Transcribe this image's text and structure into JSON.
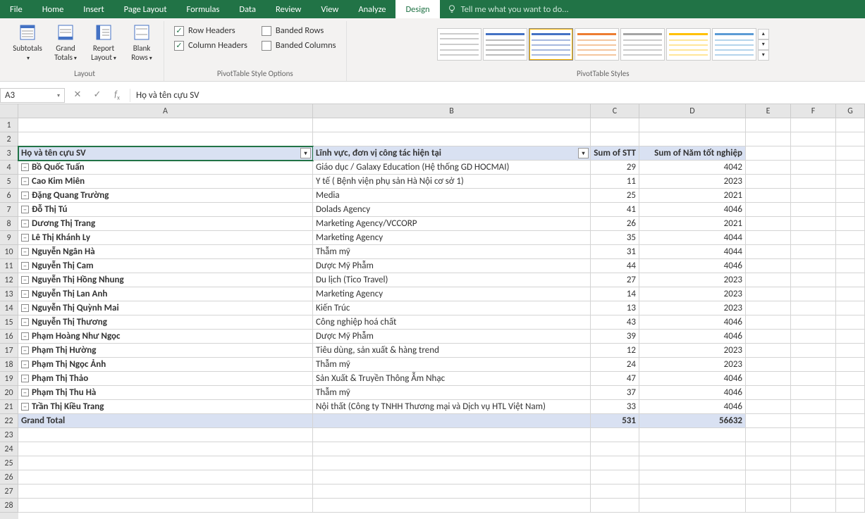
{
  "ribbon": {
    "tabs": [
      "File",
      "Home",
      "Insert",
      "Page Layout",
      "Formulas",
      "Data",
      "Review",
      "View",
      "Analyze",
      "Design"
    ],
    "active_tab": "Design",
    "tell_me": "Tell me what you want to do...",
    "groups": {
      "layout": {
        "label": "Layout",
        "buttons": {
          "subtotals": "Subtotals",
          "grand_totals": "Grand Totals",
          "report_layout": "Report Layout",
          "blank_rows": "Blank Rows"
        }
      },
      "style_options": {
        "label": "PivotTable Style Options",
        "row_headers": "Row Headers",
        "column_headers": "Column Headers",
        "banded_rows": "Banded Rows",
        "banded_columns": "Banded Columns",
        "row_headers_checked": true,
        "column_headers_checked": true,
        "banded_rows_checked": false,
        "banded_columns_checked": false
      },
      "styles": {
        "label": "PivotTable Styles"
      }
    }
  },
  "formula_bar": {
    "name_box": "A3",
    "formula": "Họ và tên cựu SV"
  },
  "columns": [
    "A",
    "B",
    "C",
    "D",
    "E",
    "F",
    "G"
  ],
  "pivot_headers": {
    "A": "Họ và tên cựu SV",
    "B": "Lĩnh vực, đơn vị công tác hiện tại",
    "C": "Sum of STT",
    "D": "Sum of Năm tốt nghiệp"
  },
  "pivot_rows": [
    {
      "name": "Bồ Quốc Tuấn",
      "b": "Giáo dục / Galaxy Education (Hệ thống GD HOCMAI)",
      "c": "29",
      "d": "4042"
    },
    {
      "name": "Cao Kim Miên",
      "b": "Y tế ( Bệnh viện phụ sản Hà Nội cơ sở 1)",
      "c": "11",
      "d": "2023"
    },
    {
      "name": "Đặng Quang Trường",
      "b": "Media",
      "c": "25",
      "d": "2021"
    },
    {
      "name": "Đỗ Thị Tú",
      "b": "Dolads Agency",
      "c": "41",
      "d": "4046"
    },
    {
      "name": "Dương Thị Trang",
      "b": "Marketing Agency/VCCORP",
      "c": "26",
      "d": "2021"
    },
    {
      "name": "Lê Thị Khánh Ly",
      "b": "Marketing Agency",
      "c": "35",
      "d": "4044"
    },
    {
      "name": "Nguyễn Ngân Hà",
      "b": "Thẫm mỹ",
      "c": "31",
      "d": "4044"
    },
    {
      "name": "Nguyễn Thị Cam",
      "b": "Dược Mỹ Phẫm",
      "c": "44",
      "d": "4046"
    },
    {
      "name": "Nguyễn Thị Hồng Nhung",
      "b": "Du lịch (Tico Travel)",
      "c": "27",
      "d": "2023"
    },
    {
      "name": "Nguyễn Thị Lan Anh",
      "b": "Marketing Agency",
      "c": "14",
      "d": "2023"
    },
    {
      "name": "Nguyễn Thị Quỳnh Mai",
      "b": "Kiến Trúc",
      "c": "13",
      "d": "2023"
    },
    {
      "name": "Nguyễn Thị Thương",
      "b": "Công nghiệp hoá chất",
      "c": "43",
      "d": "4046"
    },
    {
      "name": "Phạm Hoàng Như Ngọc",
      "b": "Dược Mỹ Phẫm",
      "c": "39",
      "d": "4046"
    },
    {
      "name": "Phạm Thị Hường",
      "b": "Tiêu dùng, sản xuất & hàng trend",
      "c": "12",
      "d": "2023"
    },
    {
      "name": "Phạm Thị Ngọc Ảnh",
      "b": "Thẫm mỹ",
      "c": "24",
      "d": "2023"
    },
    {
      "name": "Phạm Thị Thảo",
      "b": "Sản Xuất & Truyền Thông Ẫm Nhạc",
      "c": "47",
      "d": "4046"
    },
    {
      "name": "Phạm Thị Thu Hà",
      "b": "Thẫm mỹ",
      "c": "37",
      "d": "4046"
    },
    {
      "name": "Trần Thị Kiều Trang",
      "b": "Nội thất (Công ty TNHH Thương mại và Dịch vụ HTL Việt Nam)",
      "c": "33",
      "d": "4046"
    }
  ],
  "grand_total": {
    "label": "Grand Total",
    "c": "531",
    "d": "56632"
  },
  "row_numbers": [
    1,
    2,
    3,
    4,
    5,
    6,
    7,
    8,
    9,
    10,
    11,
    12,
    13,
    14,
    15,
    16,
    17,
    18,
    19,
    20,
    21,
    22,
    23,
    24,
    25,
    26,
    27,
    28
  ]
}
